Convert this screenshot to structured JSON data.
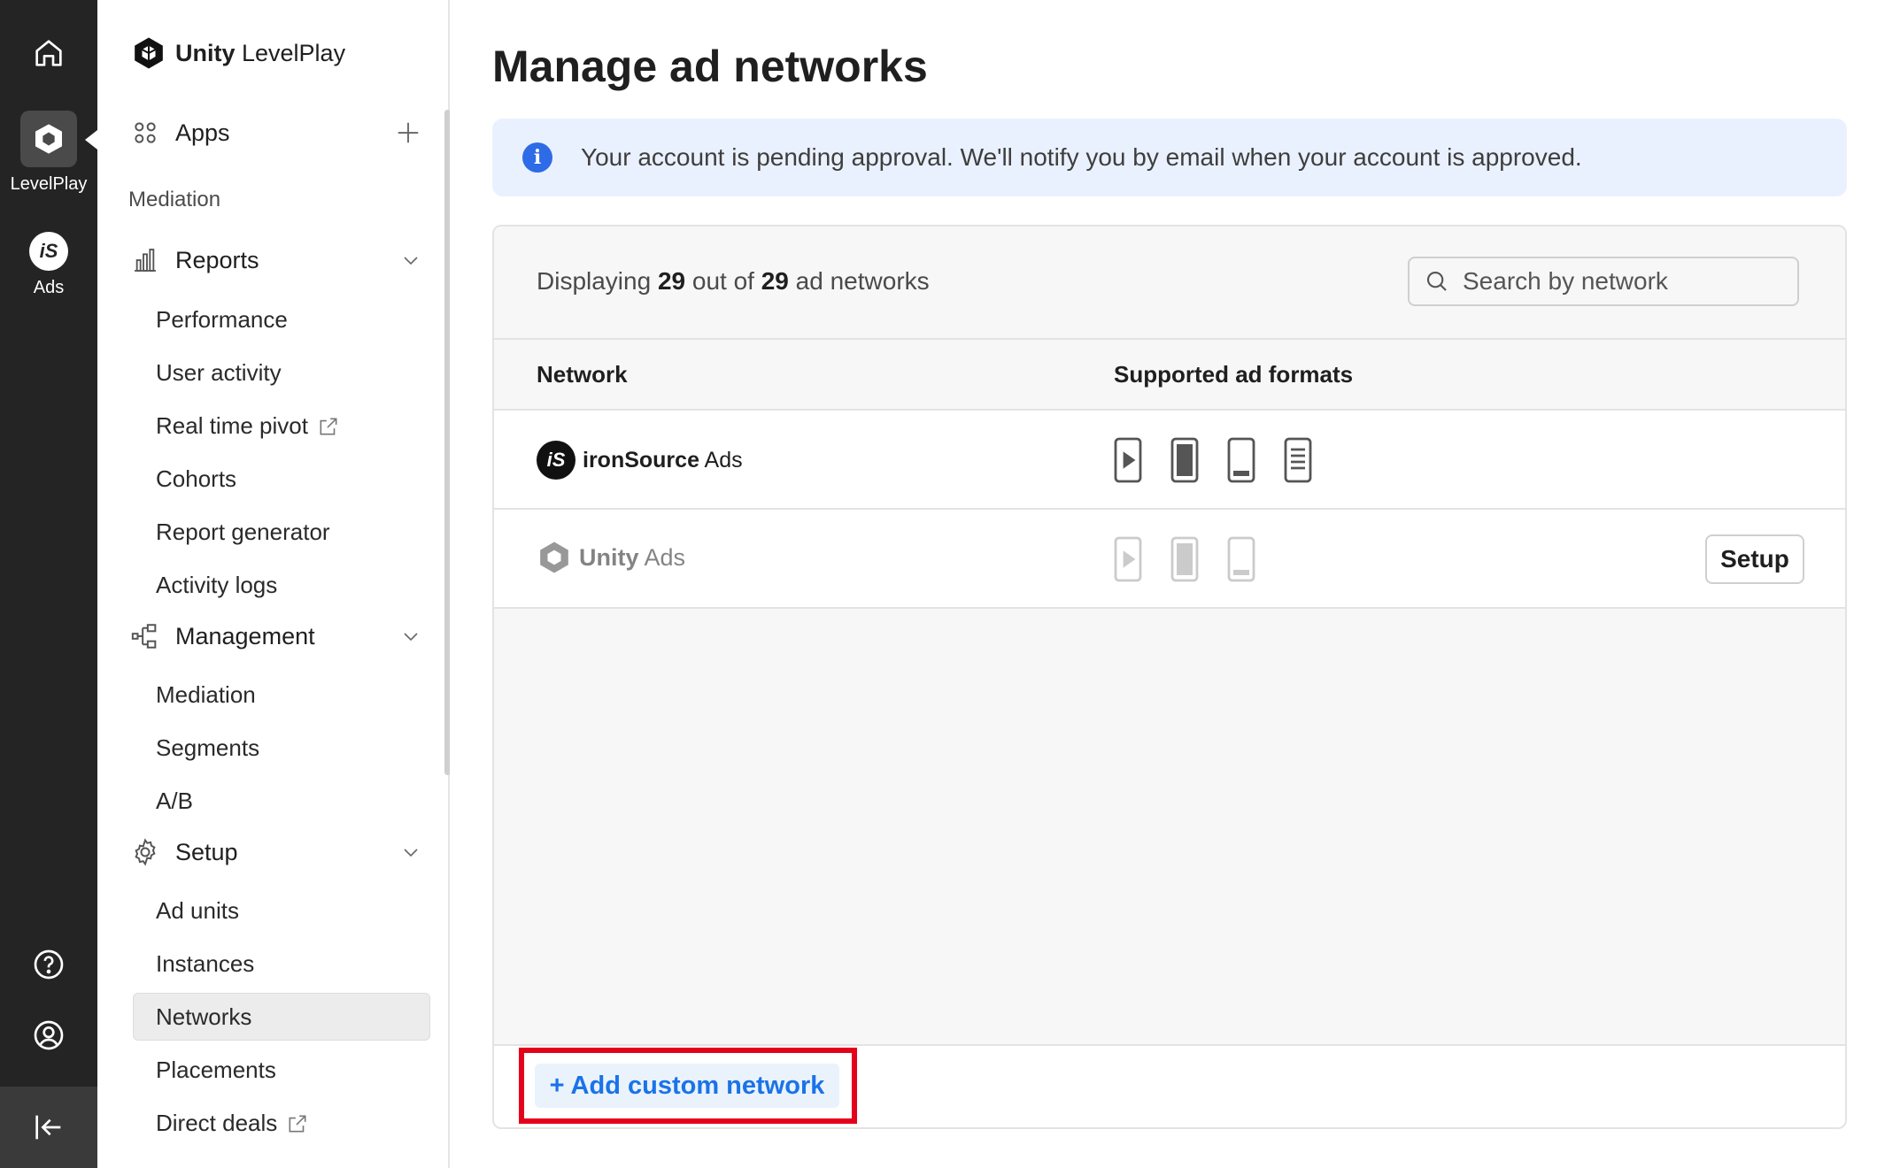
{
  "rail": {
    "levelplay_label": "LevelPlay",
    "ads_label": "Ads",
    "ads_icon_text": "iS"
  },
  "brand": {
    "bold": "Unity",
    "rest": " LevelPlay"
  },
  "sidebar": {
    "apps_label": "Apps",
    "mediation_section": "Mediation",
    "reports_label": "Reports",
    "reports_items": [
      "Performance",
      "User activity",
      "Real time pivot",
      "Cohorts",
      "Report generator",
      "Activity logs"
    ],
    "management_label": "Management",
    "management_items": [
      "Mediation",
      "Segments",
      "A/B"
    ],
    "setup_label": "Setup",
    "setup_items": [
      "Ad units",
      "Instances",
      "Networks",
      "Placements",
      "Direct deals"
    ],
    "active_item": "Networks"
  },
  "page": {
    "title": "Manage ad networks",
    "alert": "Your account is pending approval. We'll notify you by email when your account is approved.",
    "count_prefix": "Displaying",
    "count_shown": "29",
    "count_mid": "out of",
    "count_total": "29",
    "count_suffix": "ad networks",
    "search_placeholder": "Search by network",
    "col_network": "Network",
    "col_formats": "Supported ad formats",
    "networks": [
      {
        "name_bold": "ironSource",
        "name_rest": " Ads",
        "icon_text": "iS",
        "formats": [
          "rewarded-video",
          "interstitial",
          "banner",
          "native"
        ],
        "enabled": true
      },
      {
        "name_bold": "Unity",
        "name_rest": " Ads",
        "formats": [
          "rewarded-video",
          "interstitial",
          "banner"
        ],
        "enabled": false,
        "action": "Setup"
      }
    ],
    "add_custom": "+ Add custom network"
  },
  "colors": {
    "rail_bg": "#242424",
    "accent_blue": "#1a73e8",
    "info_blue": "#2e6be6",
    "highlight_red": "#e5001b"
  }
}
